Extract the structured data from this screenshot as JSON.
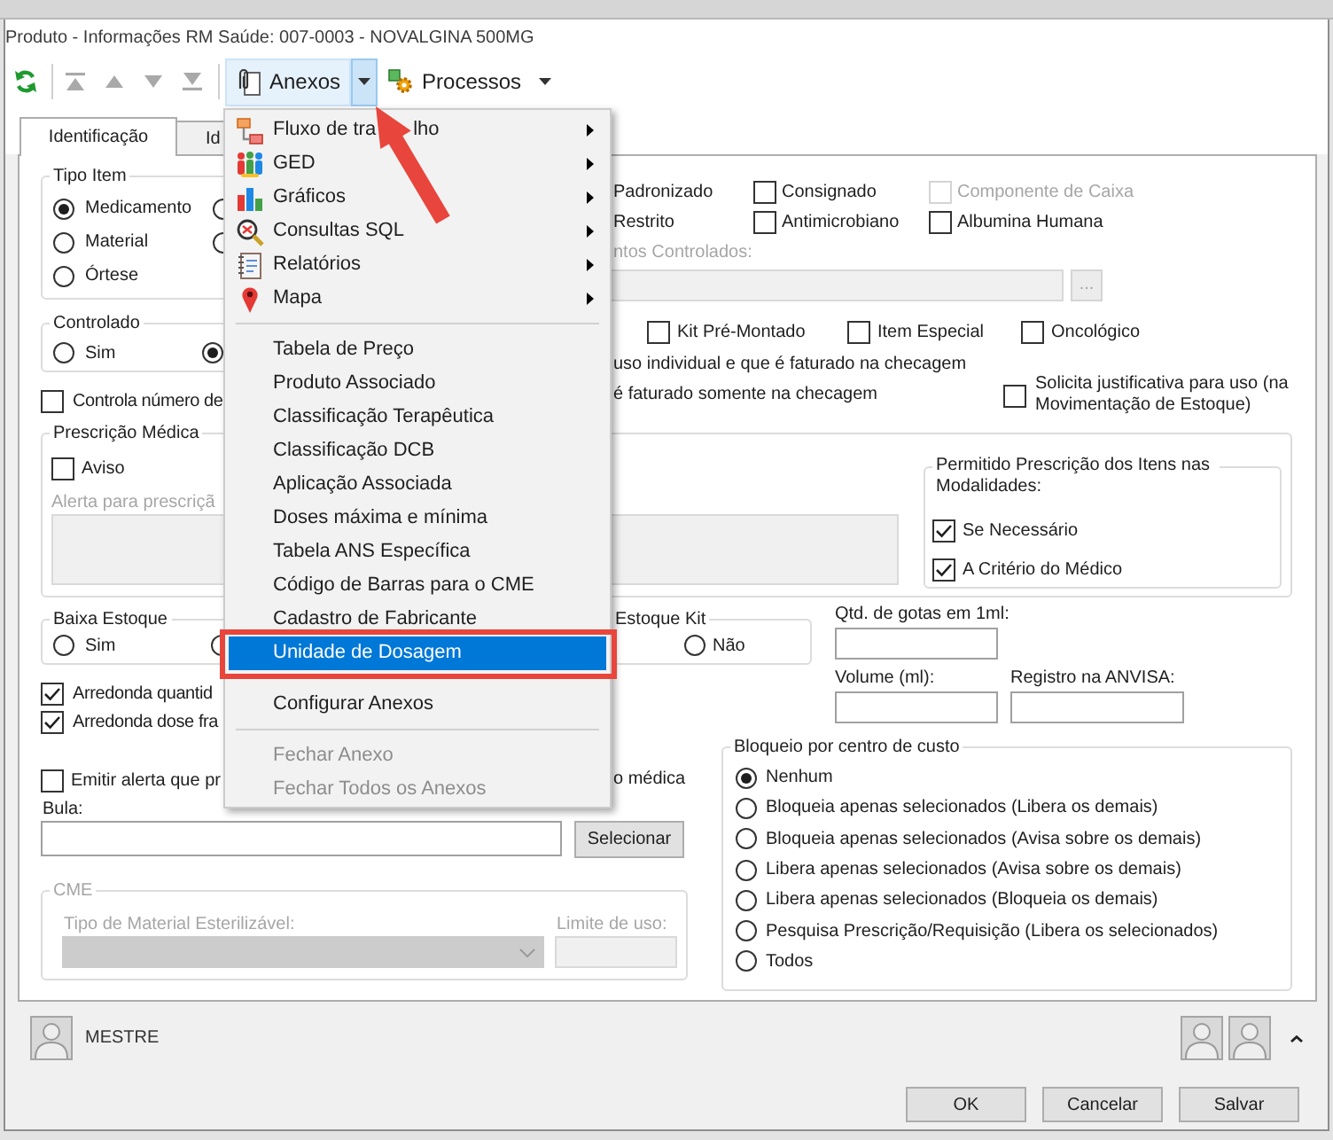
{
  "window": {
    "title": "Produto - Informações RM Saúde: 007-0003 - NOVALGINA 500MG"
  },
  "toolbar": {
    "navigation_disabled": true,
    "menus": [
      {
        "label": "Anexos",
        "open": true
      },
      {
        "label": "Processos",
        "open": false
      }
    ]
  },
  "anexos_menu": {
    "sections": [
      {
        "items": [
          {
            "label": "Fluxo de tra",
            "label_tail": "lho",
            "submenu": true,
            "selected": false,
            "disabled": false
          },
          {
            "label": "GED",
            "submenu": true,
            "selected": false,
            "disabled": false
          },
          {
            "label": "Gráficos",
            "submenu": true,
            "selected": false,
            "disabled": false
          },
          {
            "label": "Consultas SQL",
            "submenu": true,
            "selected": false,
            "disabled": false
          },
          {
            "label": "Relatórios",
            "submenu": true,
            "selected": false,
            "disabled": false
          },
          {
            "label": "Mapa",
            "submenu": true,
            "selected": false,
            "disabled": false
          }
        ]
      },
      {
        "items": [
          {
            "label": "Tabela de Preço",
            "submenu": false,
            "selected": false,
            "disabled": false
          },
          {
            "label": "Produto Associado",
            "submenu": false,
            "selected": false,
            "disabled": false
          },
          {
            "label": "Classificação Terapêutica",
            "submenu": false,
            "selected": false,
            "disabled": false
          },
          {
            "label": "Classificação DCB",
            "submenu": false,
            "selected": false,
            "disabled": false
          },
          {
            "label": "Aplicação Associada",
            "submenu": false,
            "selected": false,
            "disabled": false
          },
          {
            "label": "Doses máxima e mínima",
            "submenu": false,
            "selected": false,
            "disabled": false
          },
          {
            "label": "Tabela ANS Específica",
            "submenu": false,
            "selected": false,
            "disabled": false
          },
          {
            "label": "Código de Barras para o CME",
            "submenu": false,
            "selected": false,
            "disabled": false
          },
          {
            "label": "Cadastro de Fabricante",
            "submenu": false,
            "selected": false,
            "disabled": false
          },
          {
            "label": "Unidade de Dosagem",
            "submenu": false,
            "selected": true,
            "disabled": false
          }
        ]
      },
      {
        "items": [
          {
            "label": "Configurar Anexos",
            "submenu": false,
            "selected": false,
            "disabled": false
          }
        ]
      },
      {
        "items": [
          {
            "label": "Fechar Anexo",
            "submenu": false,
            "selected": false,
            "disabled": true
          },
          {
            "label": "Fechar Todos os Anexos",
            "submenu": false,
            "selected": false,
            "disabled": true
          }
        ]
      }
    ]
  },
  "tabs": [
    {
      "label": "Identificação",
      "selected": true
    },
    {
      "label": "Id",
      "selected": false
    }
  ],
  "tipo_item": {
    "label": "Tipo Item",
    "options": [
      {
        "label": "Medicamento",
        "selected": true
      },
      {
        "label": "Material",
        "selected": false
      },
      {
        "label": "Órtese",
        "selected": false
      }
    ],
    "column_2_options": [
      {
        "selected": false
      },
      {
        "selected": false
      }
    ]
  },
  "flag_rows": [
    {
      "cut_label": "Padronizado",
      "checkboxes": [
        {
          "label": "Consignado",
          "checked": false,
          "disabled": false
        },
        {
          "label": "Componente de Caixa",
          "checked": false,
          "disabled": true
        }
      ]
    },
    {
      "cut_label": "Restrito",
      "checkboxes": [
        {
          "label": "Antimicrobiano",
          "checked": false,
          "disabled": false
        },
        {
          "label": "Albumina Humana",
          "checked": false,
          "disabled": false
        }
      ]
    }
  ],
  "medicamentos_controlados": {
    "label": "ntos Controlados:",
    "disabled": true,
    "button": "..."
  },
  "controlado": {
    "label": "Controlado",
    "options": [
      {
        "label": "Sim",
        "selected": false
      }
    ],
    "column_2_options": [
      {
        "selected": true
      }
    ]
  },
  "kit_checkboxes": [
    {
      "label": "Kit Pré-Montado",
      "checked": false
    },
    {
      "label": "Item Especial",
      "checked": false
    },
    {
      "label": "Oncológico",
      "checked": false
    }
  ],
  "controla_numero": {
    "label": "Controla número de",
    "checked": false
  },
  "cut_lines": [
    "uso individual e que é faturado na checagem",
    "é faturado somente na checagem"
  ],
  "solicita_justificativa": {
    "label": "Solicita justificativa para uso (na Movimentação de Estoque)",
    "checked": false
  },
  "prescricao": {
    "label": "Prescrição Médica",
    "aviso": {
      "label": "Aviso",
      "checked": false
    },
    "alert_label": "Alerta para prescriçã",
    "alert_disabled": true,
    "modalidades": {
      "label": "Permitido Prescrição dos Itens nas Modalidades:",
      "options": [
        {
          "label": "Se Necessário",
          "checked": true
        },
        {
          "label": "A Critério do Médico",
          "checked": true
        }
      ]
    }
  },
  "baixa_estoque": {
    "label": "Baixa Estoque",
    "options": [
      {
        "label": "Sim",
        "selected": false
      }
    ],
    "column_2_options": [
      {
        "selected": false
      }
    ]
  },
  "estoque_kit": {
    "label": "Estoque Kit",
    "options": [
      {
        "label": "Não",
        "selected": false
      }
    ]
  },
  "gotas": {
    "label": "Qtd. de gotas em 1ml:"
  },
  "measures": [
    {
      "label": "Volume (ml):"
    },
    {
      "label": "Registro na ANVISA:"
    }
  ],
  "arredonda": [
    {
      "label": "Arredonda quantid",
      "checked": true
    },
    {
      "label": "Arredonda dose fra",
      "checked": true
    }
  ],
  "bloqueio": {
    "label": "Bloqueio por centro de custo",
    "options": [
      {
        "label": "Nenhum",
        "selected": true
      },
      {
        "label": "Bloqueia apenas selecionados (Libera os demais)",
        "selected": false
      },
      {
        "label": "Bloqueia apenas selecionados (Avisa sobre os demais)",
        "selected": false
      },
      {
        "label": "Libera apenas selecionados (Avisa sobre os demais)",
        "selected": false
      },
      {
        "label": "Libera apenas selecionados (Bloqueia os demais)",
        "selected": false
      },
      {
        "label": "Pesquisa Prescrição/Requisição (Libera os selecionados)",
        "selected": false
      },
      {
        "label": "Todos",
        "selected": false
      }
    ]
  },
  "emitir_alerta": {
    "label": "Emitir alerta que pr",
    "checked": false,
    "cut_tail": "o médica"
  },
  "bula": {
    "label": "Bula:",
    "button": "Selecionar"
  },
  "cme": {
    "label": "CME",
    "disabled": true,
    "material_label": "Tipo de Material Esterilizável:",
    "limit_label": "Limite de uso:"
  },
  "footer": {
    "user": "MESTRE",
    "buttons": [
      {
        "label": "OK"
      },
      {
        "label": "Cancelar"
      },
      {
        "label": "Salvar"
      }
    ]
  }
}
